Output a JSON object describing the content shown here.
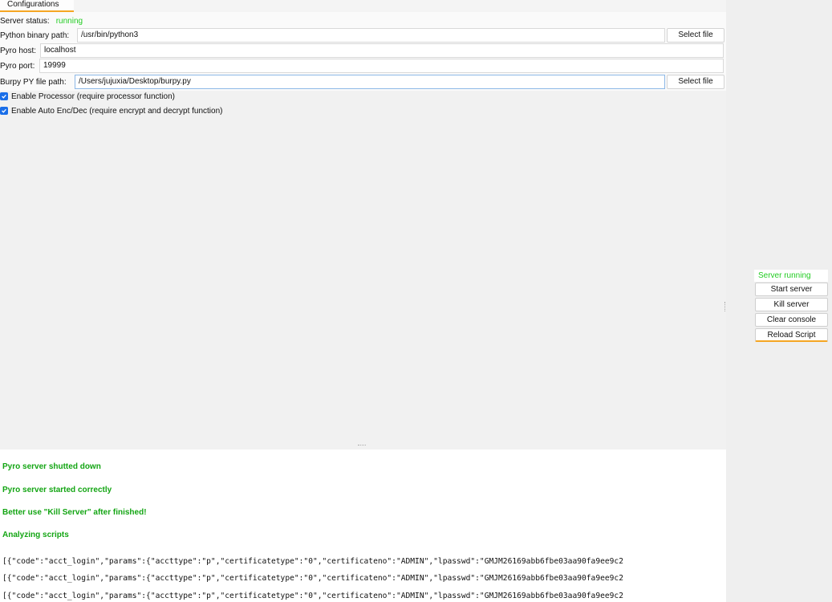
{
  "tabs": [
    {
      "label": "Configurations"
    }
  ],
  "config": {
    "server_status_label": "Server status:",
    "server_status_value": "running",
    "python_label": "Python binary path:",
    "python_value": "/usr/bin/python3",
    "pyro_host_label": "Pyro host:",
    "pyro_host_value": "localhost",
    "pyro_port_label": "Pyro port:",
    "pyro_port_value": "19999",
    "burpy_label": "Burpy PY file path:",
    "burpy_value": "/Users/jujuxia/Desktop/burpy.py",
    "select_file_label": "Select file",
    "enable_processor_label": "Enable Processor (require processor function)",
    "enable_processor_checked": true,
    "enable_autoenc_label": "Enable Auto Enc/Dec (require encrypt and decrypt function)",
    "enable_autoenc_checked": true
  },
  "console": {
    "messages": [
      "Pyro server shutted down",
      "Pyro server started correctly",
      "Better use \"Kill Server\" after finished!",
      "Analyzing scripts"
    ],
    "json_lines": [
      "[{\"code\":\"acct_login\",\"params\":{\"accttype\":\"p\",\"certificatetype\":\"0\",\"certificateno\":\"ADMIN\",\"lpasswd\":\"GMJM26169abb6fbe03aa90fa9ee9c2",
      "[{\"code\":\"acct_login\",\"params\":{\"accttype\":\"p\",\"certificatetype\":\"0\",\"certificateno\":\"ADMIN\",\"lpasswd\":\"GMJM26169abb6fbe03aa90fa9ee9c2",
      "[{\"code\":\"acct_login\",\"params\":{\"accttype\":\"p\",\"certificatetype\":\"0\",\"certificateno\":\"ADMIN\",\"lpasswd\":\"GMJM26169abb6fbe03aa90fa9ee9c2"
    ]
  },
  "side": {
    "status": "Server running",
    "buttons": [
      "Start server",
      "Kill server",
      "Clear console",
      "Reload Script"
    ]
  },
  "colors": {
    "accent": "#f5a623",
    "status_green": "#22cc22",
    "console_green": "#13a513",
    "checkbox_blue": "#1a6ee8"
  }
}
